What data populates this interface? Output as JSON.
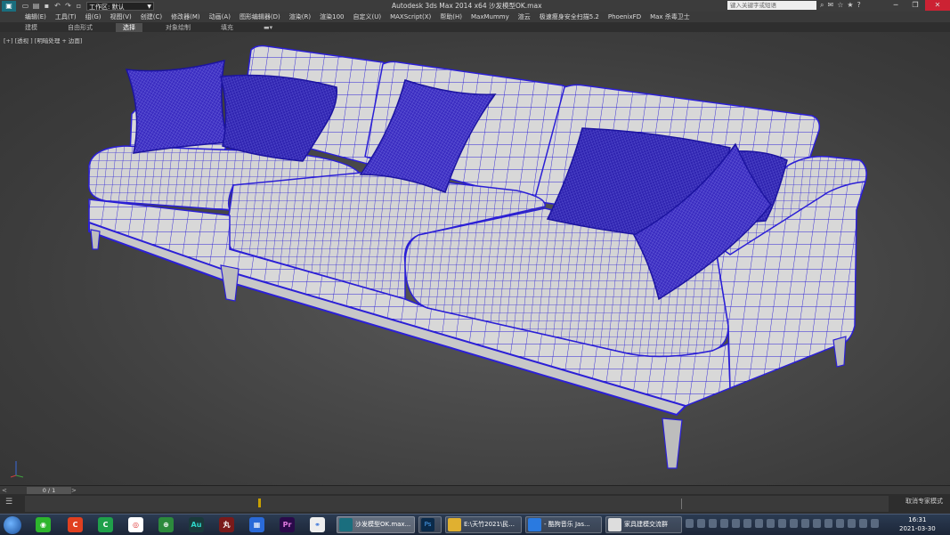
{
  "titlebar": {
    "workspace_label": "工作区: 默认",
    "doc_title": "Autodesk 3ds Max  2014 x64    沙发模型OK.max",
    "search_placeholder": "键入关键字或短语"
  },
  "menu": [
    "编辑(E)",
    "工具(T)",
    "组(G)",
    "视图(V)",
    "创建(C)",
    "修改器(M)",
    "动画(A)",
    "图形编辑器(D)",
    "渲染(R)",
    "渲染100",
    "自定义(U)",
    "MAXScript(X)",
    "帮助(H)",
    "MaxMummy",
    "渲云",
    "极速瘦身安全扫描5.2",
    "PhoenixFD",
    "Max 杀毒卫士"
  ],
  "ribbon_tabs": [
    {
      "label": "建模",
      "active": false
    },
    {
      "label": "自由形式",
      "active": false
    },
    {
      "label": "选择",
      "active": true
    },
    {
      "label": "对象绘制",
      "active": false
    },
    {
      "label": "填充",
      "active": false
    }
  ],
  "viewport": {
    "label": "[+] [透视 ] [明暗处理 + 边面]"
  },
  "timeline": {
    "frame": "0 / 1",
    "left_arrow": "<",
    "right_arrow": ">"
  },
  "status": {
    "expert_mode": "取消专家模式"
  },
  "taskbar": {
    "tasks": [
      {
        "label": "沙发模型OK.max...",
        "active": true
      },
      {
        "label": "",
        "active": false
      },
      {
        "label": "E:\\天竹2021\\民...",
        "active": false
      },
      {
        "label": "- 酷狗音乐 Jas...",
        "active": false
      },
      {
        "label": "家具建模交流群",
        "active": false
      }
    ],
    "time": "16:31",
    "date": "2021-03-30"
  },
  "colors": {
    "wire": "#2b1fd6",
    "fabric": "#d9d9d9",
    "viewport_bg": "#444444"
  }
}
